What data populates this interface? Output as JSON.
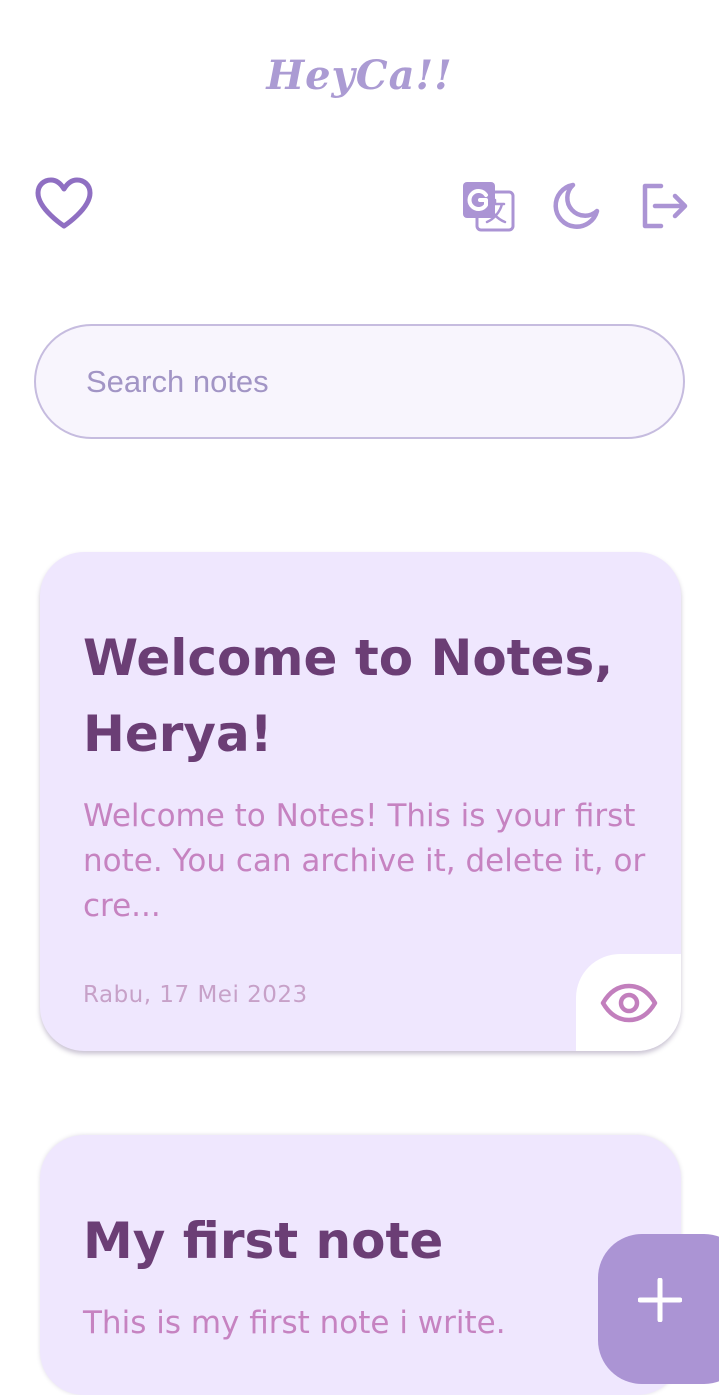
{
  "header": {
    "app_title": "HeyCa!!"
  },
  "toolbar": {
    "icons": [
      "heart-icon",
      "translate-icon",
      "moon-icon",
      "logout-icon"
    ]
  },
  "search": {
    "placeholder": "Search notes",
    "value": ""
  },
  "notes": [
    {
      "title": "Welcome to Notes, Herya!",
      "body": "Welcome to Notes! This is your first note. You can archive it, delete it, or cre...",
      "date": "Rabu, 17 Mei 2023"
    },
    {
      "title": "My first note",
      "body": "This is my first note i write."
    }
  ],
  "fab": {
    "icon": "plus-icon"
  },
  "colors": {
    "accent": "#ab94d4",
    "card_background": "#efe7fe",
    "title_text": "#6b3e75",
    "body_text": "#c683c1",
    "date_text": "#c7a1c8"
  }
}
